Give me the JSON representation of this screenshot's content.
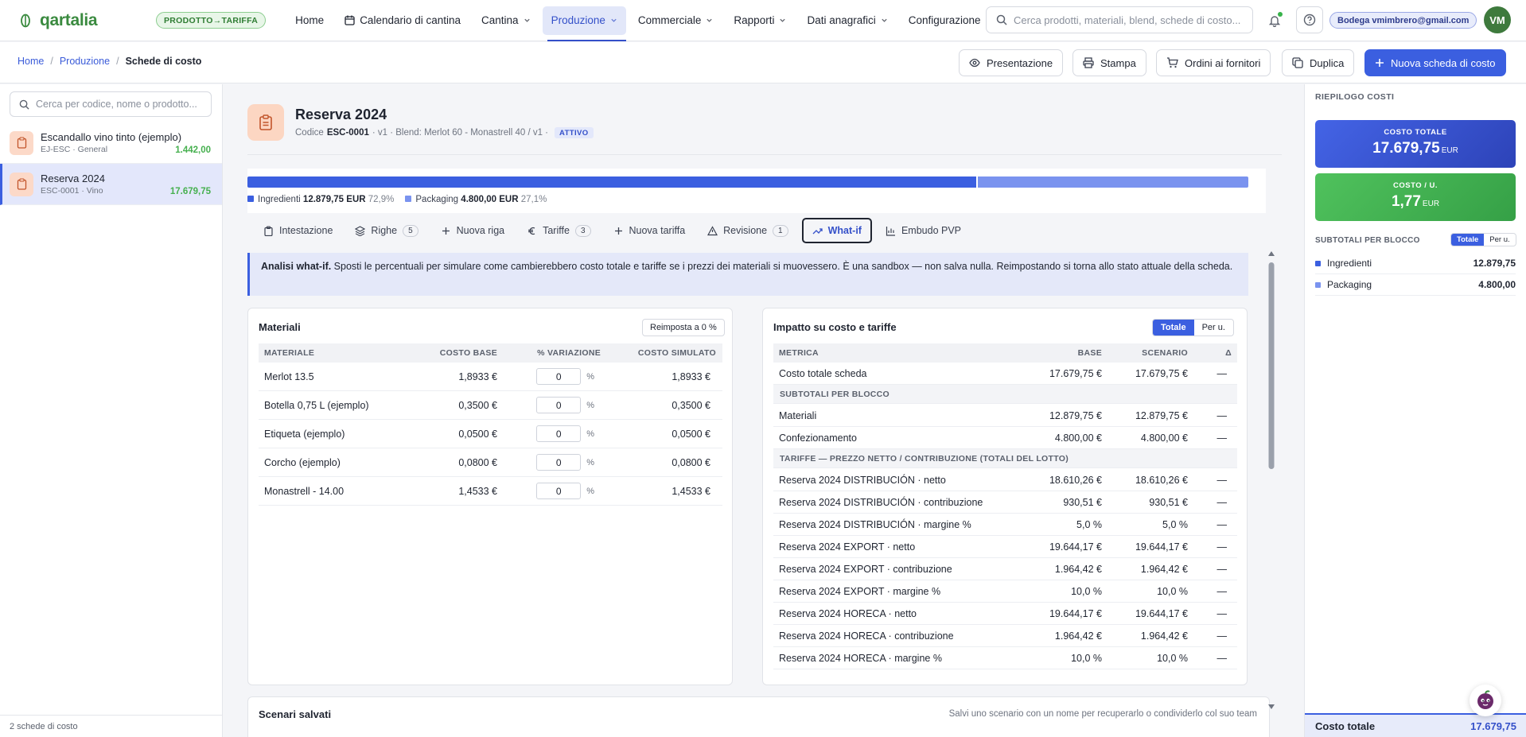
{
  "app": {
    "name": "qartalia",
    "mode_badge": "PRODOTTO→TARIFFA"
  },
  "nav": [
    {
      "label": "Home",
      "dropdown": false,
      "active": false
    },
    {
      "label": "Calendario di cantina",
      "dropdown": false,
      "active": false,
      "icon": "calendar-icon"
    },
    {
      "label": "Cantina",
      "dropdown": true,
      "active": false
    },
    {
      "label": "Produzione",
      "dropdown": true,
      "active": true
    },
    {
      "label": "Commerciale",
      "dropdown": true,
      "active": false
    },
    {
      "label": "Rapporti",
      "dropdown": true,
      "active": false
    },
    {
      "label": "Dati anagrafici",
      "dropdown": true,
      "active": false
    },
    {
      "label": "Configurazione",
      "dropdown": true,
      "active": false
    }
  ],
  "search": {
    "placeholder": "Cerca prodotti, materiali, blend, schede di costo..."
  },
  "user": {
    "email": "Bodega vmimbrero@gmail.com",
    "initials": "VM"
  },
  "breadcrumb": {
    "home": "Home",
    "section": "Produzione",
    "current": "Schede di costo"
  },
  "actions": {
    "presentazione": "Presentazione",
    "stampa": "Stampa",
    "ordini": "Ordini ai fornitori",
    "duplica": "Duplica",
    "nuova": "Nuova scheda di costo"
  },
  "sidebar": {
    "search_placeholder": "Cerca per codice, nome o prodotto...",
    "items": [
      {
        "title": "Escandallo vino tinto (ejemplo)",
        "sub": "EJ-ESC · General",
        "value": "1.442,00",
        "active": false
      },
      {
        "title": "Reserva 2024",
        "sub": "ESC-0001 · Vino",
        "value": "17.679,75",
        "active": true
      }
    ],
    "footer": "2 schede di costo"
  },
  "doc": {
    "title": "Reserva 2024",
    "code_label": "Codice",
    "code": "ESC-0001",
    "meta": "· v1 · Blend: Merlot 60 - Monastrell 40 / v1 ·",
    "status": "ATTIVO"
  },
  "breakdown": {
    "segments": [
      {
        "label": "Ingredienti",
        "amount": "12.879,75 EUR",
        "pct": "72,9%",
        "share": 72.85,
        "color": "#3b5fe0"
      },
      {
        "label": "Packaging",
        "amount": "4.800,00 EUR",
        "pct": "27,1%",
        "share": 27.15,
        "color": "#7a93ef"
      }
    ]
  },
  "tabs": [
    {
      "label": "Intestazione",
      "icon": "clipboard-icon",
      "count": null,
      "active": false
    },
    {
      "label": "Righe",
      "icon": "layers-icon",
      "count": "5",
      "active": false
    },
    {
      "label": "Nuova riga",
      "icon": "plus-icon",
      "count": null,
      "active": false
    },
    {
      "label": "Tariffe",
      "icon": "euro-icon",
      "count": "3",
      "active": false
    },
    {
      "label": "Nuova tariffa",
      "icon": "plus-icon",
      "count": null,
      "active": false
    },
    {
      "label": "Revisione",
      "icon": "warning-icon",
      "count": "1",
      "active": false
    },
    {
      "label": "What-if",
      "icon": "trend-icon",
      "count": null,
      "active": true
    },
    {
      "label": "Embudo PVP",
      "icon": "bar-chart-icon",
      "count": null,
      "active": false
    }
  ],
  "info": {
    "bold": "Analisi what-if.",
    "text": " Sposti le percentuali per simulare come cambierebbero costo totale e tariffe se i prezzi dei materiali si muovessero. È una sandbox — non salva nulla. Reimpostando si torna allo stato attuale della scheda."
  },
  "materials": {
    "title": "Materiali",
    "reset": "Reimposta a 0 %",
    "headers": [
      "MATERIALE",
      "COSTO BASE",
      "% VARIAZIONE",
      "COSTO SIMULATO"
    ],
    "rows": [
      {
        "name": "Merlot 13.5",
        "base": "1,8933 €",
        "pct": "0",
        "sim": "1,8933 €"
      },
      {
        "name": "Botella 0,75 L (ejemplo)",
        "base": "0,3500 €",
        "pct": "0",
        "sim": "0,3500 €"
      },
      {
        "name": "Etiqueta (ejemplo)",
        "base": "0,0500 €",
        "pct": "0",
        "sim": "0,0500 €"
      },
      {
        "name": "Corcho (ejemplo)",
        "base": "0,0800 €",
        "pct": "0",
        "sim": "0,0800 €"
      },
      {
        "name": "Monastrell - 14.00",
        "base": "1,4533 €",
        "pct": "0",
        "sim": "1,4533 €"
      }
    ],
    "pct_sign": "%"
  },
  "impact": {
    "title": "Impatto su costo e tariffe",
    "toggle": [
      "Totale",
      "Per u."
    ],
    "headers": [
      "METRICA",
      "BASE",
      "SCENARIO",
      "Δ"
    ],
    "total_row": {
      "metric": "Costo totale scheda",
      "base": "17.679,75 €",
      "scenario": "17.679,75 €",
      "delta": "—"
    },
    "section1": "SUBTOTALI PER BLOCCO",
    "subtotals": [
      {
        "metric": "Materiali",
        "base": "12.879,75 €",
        "scenario": "12.879,75 €",
        "delta": "—"
      },
      {
        "metric": "Confezionamento",
        "base": "4.800,00 €",
        "scenario": "4.800,00 €",
        "delta": "—"
      }
    ],
    "section2": "TARIFFE — PREZZO NETTO / CONTRIBUZIONE (TOTALI DEL LOTTO)",
    "tariffs": [
      {
        "metric": "Reserva 2024 DISTRIBUCIÓN · netto",
        "base": "18.610,26 €",
        "scenario": "18.610,26 €",
        "delta": "—"
      },
      {
        "metric": "Reserva 2024 DISTRIBUCIÓN · contribuzione",
        "base": "930,51 €",
        "scenario": "930,51 €",
        "delta": "—"
      },
      {
        "metric": "Reserva 2024 DISTRIBUCIÓN · margine %",
        "base": "5,0 %",
        "scenario": "5,0 %",
        "delta": "—"
      },
      {
        "metric": "Reserva 2024 EXPORT · netto",
        "base": "19.644,17 €",
        "scenario": "19.644,17 €",
        "delta": "—"
      },
      {
        "metric": "Reserva 2024 EXPORT · contribuzione",
        "base": "1.964,42 €",
        "scenario": "1.964,42 €",
        "delta": "—"
      },
      {
        "metric": "Reserva 2024 EXPORT · margine %",
        "base": "10,0 %",
        "scenario": "10,0 %",
        "delta": "—"
      },
      {
        "metric": "Reserva 2024 HORECA · netto",
        "base": "19.644,17 €",
        "scenario": "19.644,17 €",
        "delta": "—"
      },
      {
        "metric": "Reserva 2024 HORECA · contribuzione",
        "base": "1.964,42 €",
        "scenario": "1.964,42 €",
        "delta": "—"
      },
      {
        "metric": "Reserva 2024 HORECA · margine %",
        "base": "10,0 %",
        "scenario": "10,0 %",
        "delta": "—"
      }
    ]
  },
  "scenari": {
    "title": "Scenari salvati",
    "hint": "Salvi uno scenario con un nome per recuperarlo o condividerlo col suo team"
  },
  "summary": {
    "title": "RIEPILOGO COSTI",
    "total_label": "COSTO TOTALE",
    "total_value": "17.679,75",
    "unit_label": "COSTO / U.",
    "unit_value": "1,77",
    "currency": "EUR",
    "sub_title": "SUBTOTALI PER BLOCCO",
    "toggle": [
      "Totale",
      "Per u."
    ],
    "rows": [
      {
        "label": "Ingredienti",
        "value": "12.879,75",
        "color": "#3b5fe0"
      },
      {
        "label": "Packaging",
        "value": "4.800,00",
        "color": "#7a93ef"
      }
    ],
    "footer_label": "Costo totale",
    "footer_value": "17.679,75"
  }
}
